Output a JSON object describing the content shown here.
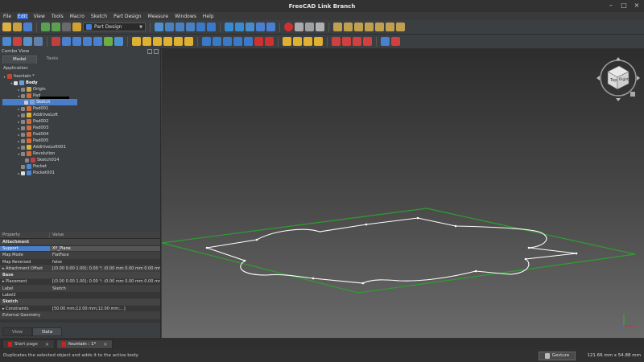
{
  "window": {
    "title": "FreeCAD Link Branch"
  },
  "menu": [
    "File",
    "Edit",
    "View",
    "Tools",
    "Macro",
    "Sketch",
    "Part Design",
    "Measure",
    "Windows",
    "Help"
  ],
  "menu_active_index": 1,
  "toolbar": {
    "workbench": "Part Design"
  },
  "combo": {
    "title": "Combo View",
    "tabs": [
      "Model",
      "Tasks"
    ],
    "active_tab": "Model"
  },
  "tree": {
    "section": "Application",
    "nodes": [
      {
        "label": "fountain *",
        "icon": "document-icon",
        "color": "#c6462e"
      },
      {
        "label": "Body",
        "icon": "body-icon",
        "color": "#6a9fdc"
      },
      {
        "label": "Origin",
        "icon": "origin-icon",
        "color": "#c6a94a"
      },
      {
        "label": "Pad",
        "icon": "pad-icon",
        "color": "#d46a3a"
      },
      {
        "label": "Sketch",
        "icon": "sketch-icon",
        "color": "#7aa3d6"
      },
      {
        "label": "Pad001",
        "icon": "pad-icon",
        "color": "#d46a3a"
      },
      {
        "label": "AdditiveLoft",
        "icon": "loft-icon",
        "color": "#e0b030"
      },
      {
        "label": "Pad002",
        "icon": "pad-icon",
        "color": "#d46a3a"
      },
      {
        "label": "Pad003",
        "icon": "pad-icon",
        "color": "#d46a3a"
      },
      {
        "label": "Pad004",
        "icon": "pad-icon",
        "color": "#d46a3a"
      },
      {
        "label": "Pad005",
        "icon": "pad-icon",
        "color": "#d46a3a"
      },
      {
        "label": "AdditiveLoft001",
        "icon": "loft-icon",
        "color": "#e0b030"
      },
      {
        "label": "Revolution",
        "icon": "revolution-icon",
        "color": "#d46a3a"
      },
      {
        "label": "Sketch014",
        "icon": "sketch-icon",
        "color": "#7aa3d6"
      },
      {
        "label": "Pocket",
        "icon": "pocket-icon",
        "color": "#4a87d0"
      },
      {
        "label": "Pocket001",
        "icon": "pocket-icon",
        "color": "#4a87d0"
      }
    ]
  },
  "properties": {
    "col_property": "Property",
    "col_value": "Value",
    "rows": [
      {
        "group": "Attachment"
      },
      {
        "k": "Support",
        "v": "XY_Plane"
      },
      {
        "k": "Map Mode",
        "v": "FlatFace"
      },
      {
        "k": "Map Reversed",
        "v": "false"
      },
      {
        "k": "Attachment Offset",
        "v": "[(0.00 0.00 1.00); 0.00 °; (0.00 mm  0.00 mm  0.00 mm)]"
      },
      {
        "group": "Base"
      },
      {
        "k": "Placement",
        "v": "[(0.00 0.00 1.00); 0.00 °; (0.00 mm  0.00 mm  0.00 mm)]"
      },
      {
        "k": "Label",
        "v": "Sketch"
      },
      {
        "k": "Label2",
        "v": ""
      },
      {
        "group": "Sketch"
      },
      {
        "k": "Constraints",
        "v": "[50.00 mm;12.00 mm;12.00 mm;...]"
      },
      {
        "k": "External Geometry",
        "v": ""
      }
    ]
  },
  "view_tabs": [
    "View",
    "Data"
  ],
  "active_view_tab": "Data",
  "doc_tabs": [
    {
      "label": "Start page"
    },
    {
      "label": "fountain : 1*"
    }
  ],
  "status": {
    "message": "Duplicates the selected object and adds it to the active body",
    "navigation": "Gesture",
    "dimensions": "121.66 mm x 54.88 mm"
  },
  "navcube": {
    "front_face": "Top",
    "right_face": "Right"
  },
  "colors": {
    "selection": "#4a7ec8",
    "sketch_plane": "#2f9e2f",
    "sketch_profile": "#ffffff"
  }
}
